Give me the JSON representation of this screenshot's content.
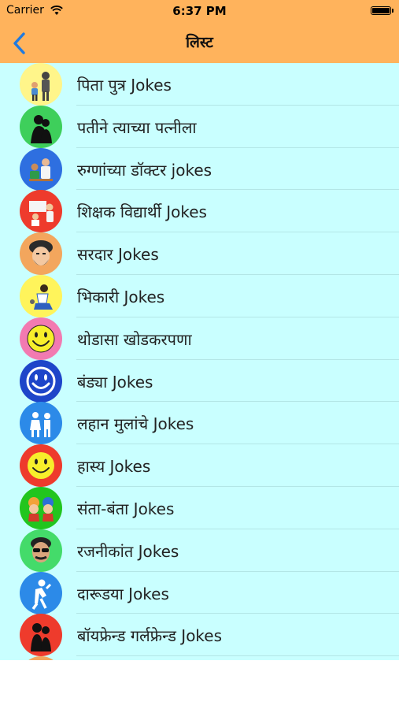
{
  "status": {
    "carrier": "Carrier",
    "time": "6:37 PM"
  },
  "nav": {
    "title": "लिस्ट"
  },
  "list": {
    "items": [
      {
        "label": "पिता पुत्र Jokes",
        "icon": "father-son-icon",
        "bg": "#fff58a"
      },
      {
        "label": "पतीने त्याच्या पत्नीला",
        "icon": "couple-silhouette-icon",
        "bg": "#3ecf5b"
      },
      {
        "label": "रुग्णांच्या डॉक्टर jokes",
        "icon": "doctor-patient-icon",
        "bg": "#2e6fe0"
      },
      {
        "label": "शिक्षक विद्यार्थी Jokes",
        "icon": "teacher-student-icon",
        "bg": "#ee3b2c"
      },
      {
        "label": "सरदार Jokes",
        "icon": "sardar-face-icon",
        "bg": "#f3a65d"
      },
      {
        "label": "भिकारी Jokes",
        "icon": "beggar-icon",
        "bg": "#fff45b"
      },
      {
        "label": "थोडासा खोडकरपणा",
        "icon": "smiley-pink-icon",
        "bg": "#f27ab1"
      },
      {
        "label": "बंड्या Jokes",
        "icon": "smiley-blue-icon",
        "bg": "#1e45c9"
      },
      {
        "label": "लहान मुलांचे Jokes",
        "icon": "children-icon",
        "bg": "#2c8ae8"
      },
      {
        "label": "हास्य Jokes",
        "icon": "smiley-red-icon",
        "bg": "#ee3b2c"
      },
      {
        "label": "संता-बंता Jokes",
        "icon": "santa-banta-icon",
        "bg": "#22c51e"
      },
      {
        "label": "रजनीकांत Jokes",
        "icon": "rajinikanth-icon",
        "bg": "#44db6a"
      },
      {
        "label": "दारूडया Jokes",
        "icon": "drunkard-icon",
        "bg": "#2c8ae8"
      },
      {
        "label": "बॉयफ्रेन्ड गर्लफ्रेन्ड Jokes",
        "icon": "bf-gf-icon",
        "bg": "#ee3b2c"
      },
      {
        "label": "",
        "icon": "next-item-icon",
        "bg": "#f3a65d"
      }
    ]
  },
  "colors": {
    "header": "#ffb35c",
    "list_bg": "#c9ffff",
    "back": "#1f7ae0"
  }
}
